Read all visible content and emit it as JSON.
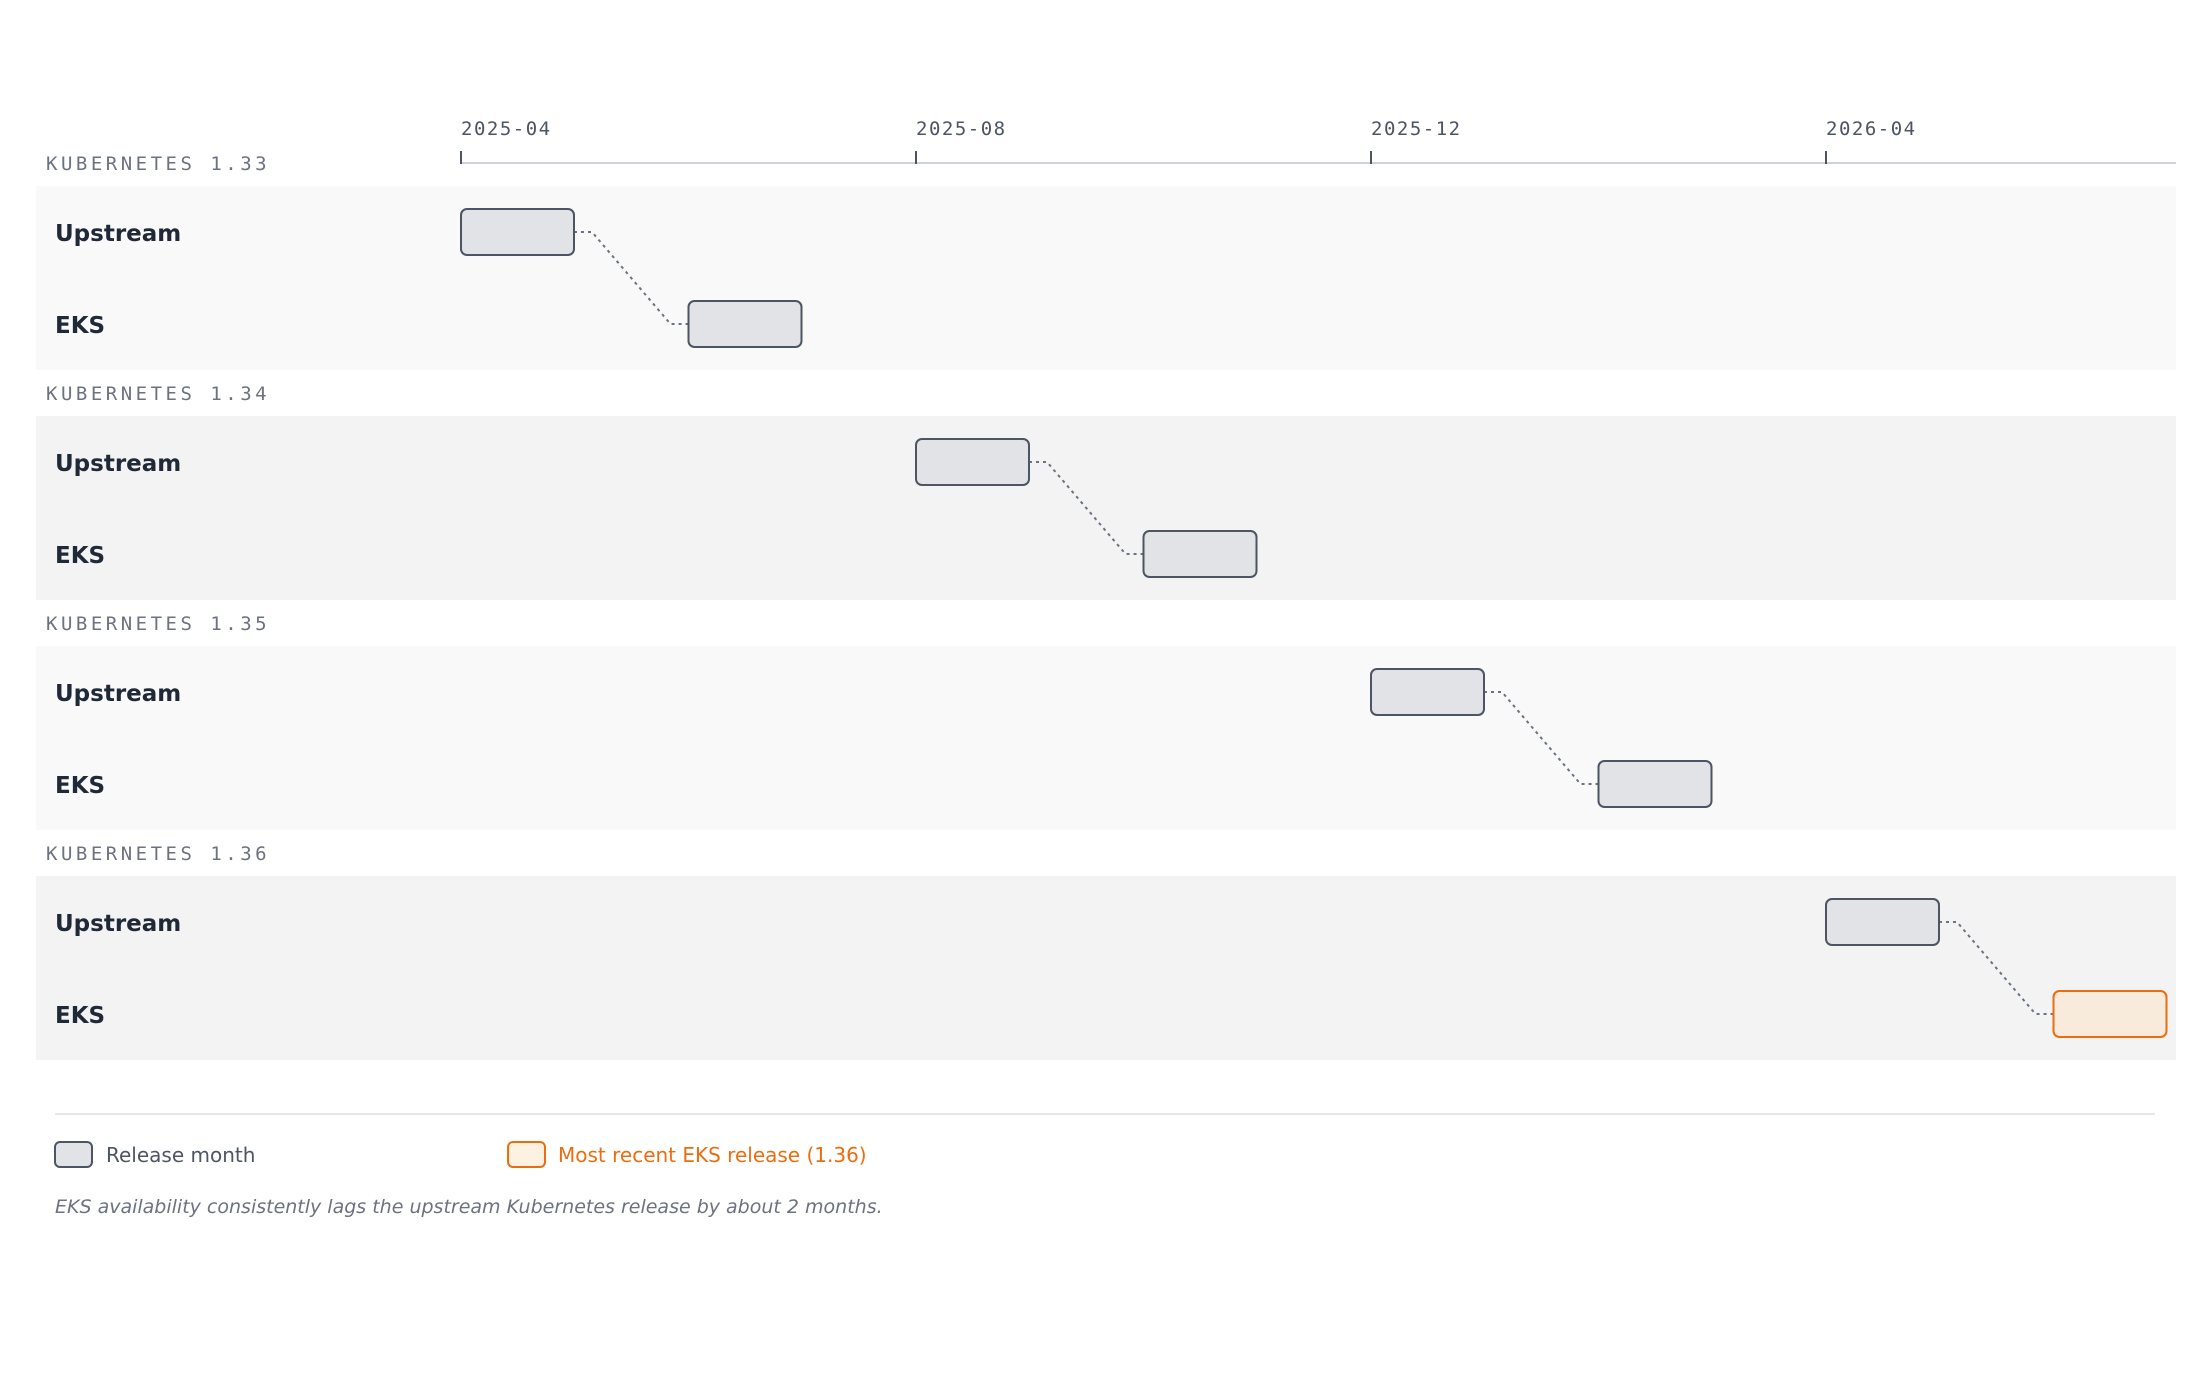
{
  "chart_data": {
    "type": "timeline",
    "x_ticks": [
      "2025-04",
      "2025-08",
      "2025-12",
      "2026-04"
    ],
    "x_range": [
      "2025-04",
      "2026-07"
    ],
    "row_labels": [
      "Upstream",
      "EKS"
    ],
    "groups": [
      {
        "label": "KUBERNETES 1.33",
        "upstream": "2025-04",
        "eks": "2025-06",
        "highlight": false
      },
      {
        "label": "KUBERNETES 1.34",
        "upstream": "2025-08",
        "eks": "2025-10",
        "highlight": false
      },
      {
        "label": "KUBERNETES 1.35",
        "upstream": "2025-12",
        "eks": "2026-02",
        "highlight": false
      },
      {
        "label": "KUBERNETES 1.36",
        "upstream": "2026-04",
        "eks": "2026-06",
        "highlight": true
      }
    ],
    "legend": {
      "release_month": "Release month",
      "most_recent": "Most recent EKS release (1.36)"
    },
    "footnote": "EKS availability consistently lags the upstream Kubernetes release by about 2 months."
  },
  "colors": {
    "bar_fill": "#e2e3e6",
    "bar_stroke": "#4b5563",
    "highlight_fill": "#f8ebdc",
    "highlight_stroke": "#ea6e10",
    "band_odd": "#f9f9f9",
    "band_even": "#f3f3f3",
    "axis": "#cfd2d6",
    "connector": "#6b7280"
  }
}
